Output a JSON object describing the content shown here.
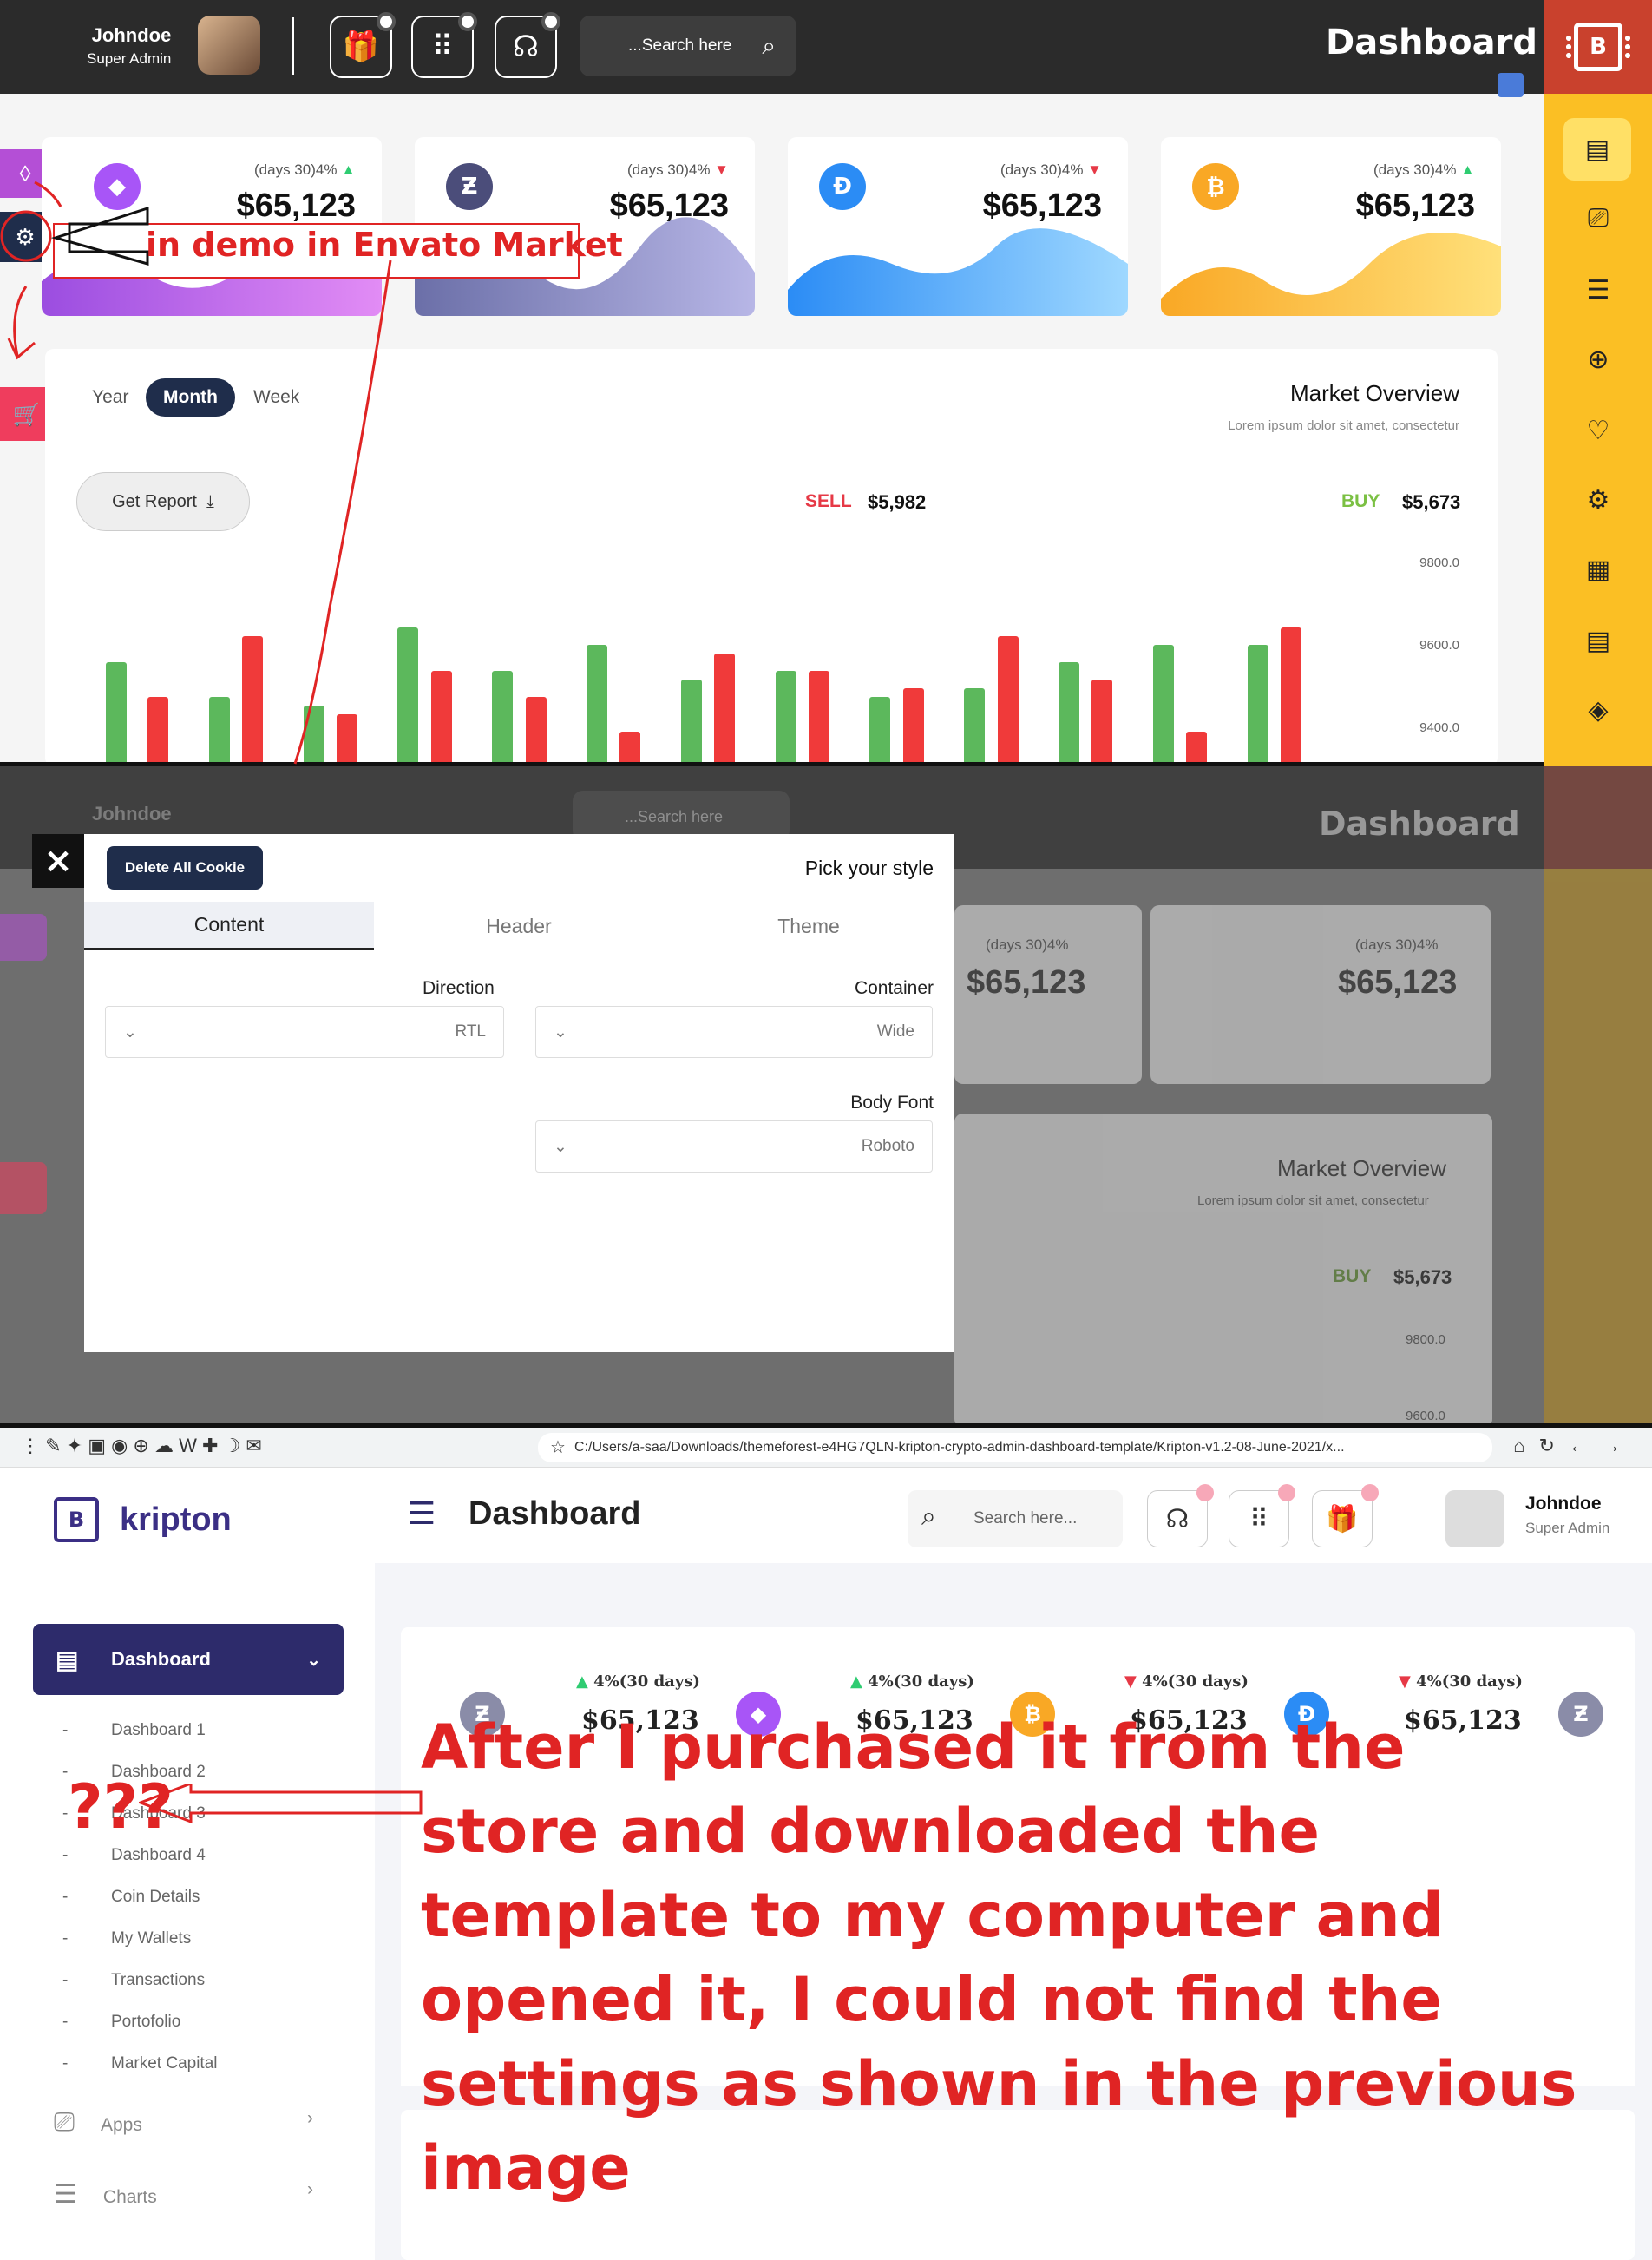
{
  "panel1": {
    "header": {
      "user_name": "Johndoe",
      "user_role": "Super Admin",
      "search_placeholder": "...Search here",
      "title": "Dashboard",
      "brand_icon": "bitcoin-chip-icon"
    },
    "cards": [
      {
        "percent": "(days 30)4%",
        "trend": "up",
        "value": "$65,123",
        "coin_icon": "ethereum-icon",
        "color": "#a855f7"
      },
      {
        "percent": "(days 30)4%",
        "trend": "down",
        "value": "$65,123",
        "coin_icon": "zcash-icon",
        "color": "#6b6fa8"
      },
      {
        "percent": "(days 30)4%",
        "trend": "down",
        "value": "$65,123",
        "coin_icon": "dash-icon",
        "color": "#2b8cf5"
      },
      {
        "percent": "(days 30)4%",
        "trend": "up",
        "value": "$65,123",
        "coin_icon": "bitcoin-icon",
        "color": "#f9a825"
      }
    ],
    "market": {
      "tabs": [
        "Year",
        "Month",
        "Week"
      ],
      "active_tab": "Month",
      "get_report": "Get Report",
      "title": "Market Overview",
      "subtitle": "Lorem ipsum dolor sit amet, consectetur",
      "sell_label": "SELL",
      "sell_value": "$5,982",
      "buy_label": "BUY",
      "buy_value": "$5,673",
      "y_ticks": [
        "9800.0",
        "9600.0",
        "9400.0"
      ]
    },
    "annotation": "in demo in Envato Market"
  },
  "panel2": {
    "delete_cookie": "Delete All Cookie",
    "pick_style": "Pick your style",
    "tabs": [
      "Content",
      "Header",
      "Theme"
    ],
    "active_tab": "Content",
    "direction_label": "Direction",
    "direction_value": "RTL",
    "container_label": "Container",
    "container_value": "Wide",
    "body_font_label": "Body Font",
    "body_font_value": "Roboto",
    "bg": {
      "user_name": "Johndoe",
      "search_placeholder": "...Search here",
      "title": "Dashboard",
      "card_percent": "(days 30)4%",
      "card_value": "$65,123",
      "market_title": "Market Overview",
      "market_subtitle": "Lorem ipsum dolor sit amet, consectetur",
      "buy_label": "BUY",
      "buy_value": "$5,673",
      "y_ticks": [
        "9800.0",
        "9600.0"
      ]
    }
  },
  "panel3": {
    "url": "C:/Users/a-saa/Downloads/themeforest-e4HG7QLN-kripton-crypto-admin-dashboard-template/Kripton-v1.2-08-June-2021/x...",
    "logo_text": "kripton",
    "page_title": "Dashboard",
    "search_placeholder": "Search here...",
    "user_name": "Johndoe",
    "user_role": "Super Admin",
    "nav_dashboard": "Dashboard",
    "sub_items": [
      "Dashboard 1",
      "Dashboard 2",
      "Dashboard 3",
      "Dashboard 4",
      "Coin Details",
      "My Wallets",
      "Transactions",
      "Portofolio",
      "Market Capital"
    ],
    "nav_apps": "Apps",
    "nav_charts": "Charts",
    "cards": [
      {
        "title": "4%(30 days)",
        "value": "$65,123",
        "trend": "up",
        "icon": "ethereum-icon",
        "color": "#a855f7"
      },
      {
        "title": "4%(30 days)",
        "value": "$65,123",
        "trend": "up",
        "icon": "bitcoin-icon",
        "color": "#f9a825"
      },
      {
        "title": "4%(30 days)",
        "value": "$65,123",
        "trend": "down",
        "icon": "dash-icon",
        "color": "#2b8cf5"
      },
      {
        "title": "4%(30 days)",
        "value": "$65,123",
        "trend": "down",
        "icon": "zcash-icon",
        "color": "#8a8ca8"
      }
    ],
    "annotation_marks": "???",
    "annotation": "After I purchased it from the store and downloaded the template to my computer and opened it, I could not find the settings as shown in the previous image"
  }
}
